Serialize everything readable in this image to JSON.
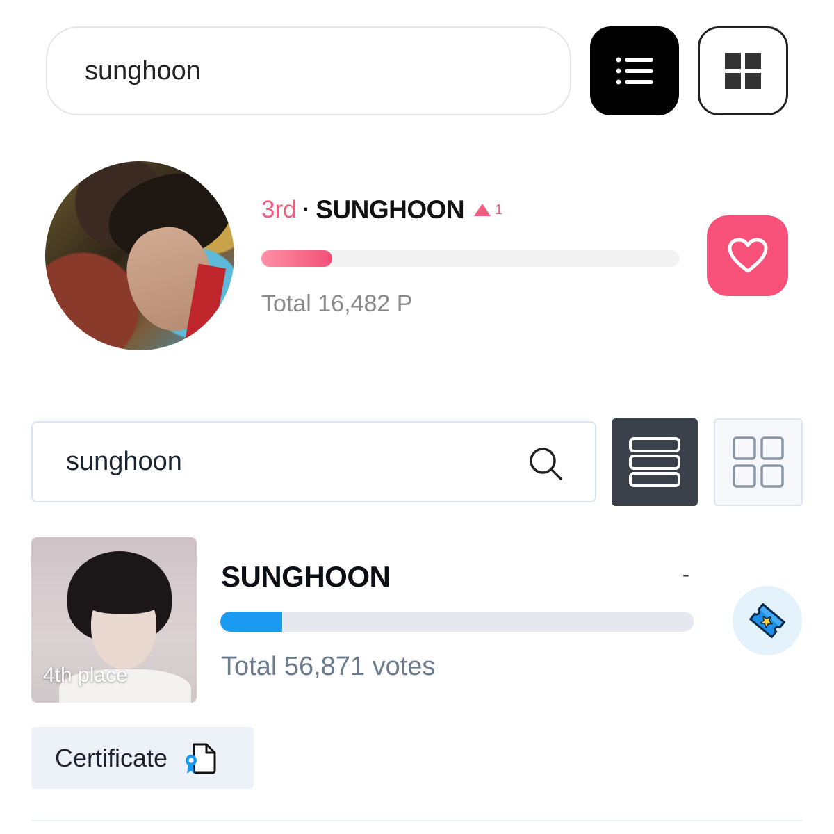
{
  "section1": {
    "search": {
      "value": "sunghoon"
    },
    "list_view_icon": "list-icon",
    "grid_view_icon": "grid-icon",
    "result": {
      "rank": "3rd",
      "separator": "·",
      "name": "SUNGHOON",
      "rank_change": "1",
      "rank_change_direction": "up",
      "progress_fraction": 0.17,
      "total": "Total 16,482 P",
      "accent_color": "#f7517a"
    },
    "heart_icon": "heart-icon"
  },
  "section2": {
    "search": {
      "value": "sunghoon"
    },
    "search_icon": "search-icon",
    "list_view_icon": "list-rows-icon",
    "grid_view_icon": "grid-outline-icon",
    "result": {
      "place": "4th place",
      "name": "SUNGHOON",
      "change": "-",
      "progress_fraction": 0.13,
      "total": "Total 56,871 votes",
      "accent_color": "#1a9af0"
    },
    "ticket_icon": "ticket-icon",
    "certificate": {
      "label": "Certificate",
      "icon": "certificate-icon"
    }
  }
}
